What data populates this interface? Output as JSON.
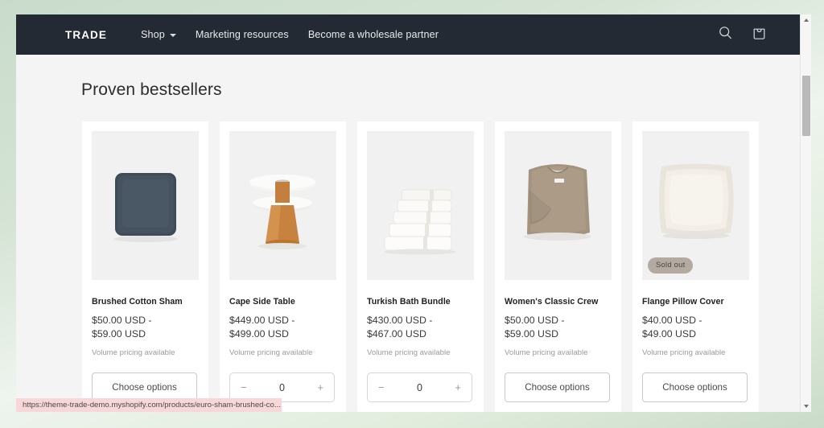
{
  "browser": {
    "status_bar_url": "https://theme-trade-demo.myshopify.com/products/euro-sham-brushed-co...",
    "scrollbar": {
      "up_arrow": "scroll-up",
      "down_arrow": "scroll-down"
    }
  },
  "header": {
    "brand": "TRADE",
    "background_color": "#232a33",
    "nav": [
      {
        "label": "Shop",
        "has_dropdown": true
      },
      {
        "label": "Marketing resources",
        "has_dropdown": false
      },
      {
        "label": "Become a wholesale partner",
        "has_dropdown": false
      }
    ],
    "actions": [
      {
        "name": "search-icon",
        "label": "Search"
      },
      {
        "name": "cart-icon",
        "label": "Cart"
      }
    ]
  },
  "main": {
    "title": "Proven bestsellers",
    "volume_note": "Volume pricing available",
    "choose_options_label": "Choose options",
    "sold_out_label": "Sold out",
    "products": [
      {
        "title": "Brushed Cotton Sham",
        "price": "$50.00 USD - $59.00 USD",
        "price_line1": "$50.00 USD -",
        "price_line2": "$59.00 USD",
        "note": "Volume pricing available",
        "action": "choose",
        "sold_out": false,
        "image": "navy-square-pillow"
      },
      {
        "title": "Cape Side Table",
        "price": "$449.00 USD - $499.00 USD",
        "price_line1": "$449.00 USD -",
        "price_line2": "$499.00 USD",
        "note": "Volume pricing available",
        "action": "quantity",
        "quantity": "0",
        "sold_out": false,
        "image": "marble-wood-side-table"
      },
      {
        "title": "Turkish Bath Bundle",
        "price": "$430.00 USD - $467.00 USD",
        "price_line1": "$430.00 USD -",
        "price_line2": "$467.00 USD",
        "note": "Volume pricing available",
        "action": "quantity",
        "quantity": "0",
        "sold_out": false,
        "image": "stacked-white-towels"
      },
      {
        "title": "Women's Classic Crew",
        "price": "$50.00 USD - $59.00 USD",
        "price_line1": "$50.00 USD -",
        "price_line2": "$59.00 USD",
        "note": "Volume pricing available",
        "action": "choose",
        "sold_out": false,
        "image": "taupe-folded-sweatshirt"
      },
      {
        "title": "Flange Pillow Cover",
        "price": "$40.00 USD - $49.00 USD",
        "price_line1": "$40.00 USD -",
        "price_line2": "$49.00 USD",
        "note": "Volume pricing available",
        "action": "choose",
        "sold_out": true,
        "image": "cream-flange-pillow"
      }
    ],
    "quantity_minus_label": "−",
    "quantity_plus_label": "+"
  },
  "colors": {
    "page_background": "#f4f4f4",
    "card_background": "#ffffff",
    "media_well": "#f1f1f1",
    "header_dark": "#232a33",
    "desktop_background": "#c9dccb",
    "sold_out_badge": "#b3aba1",
    "status_bar": "#f7d7d7"
  }
}
